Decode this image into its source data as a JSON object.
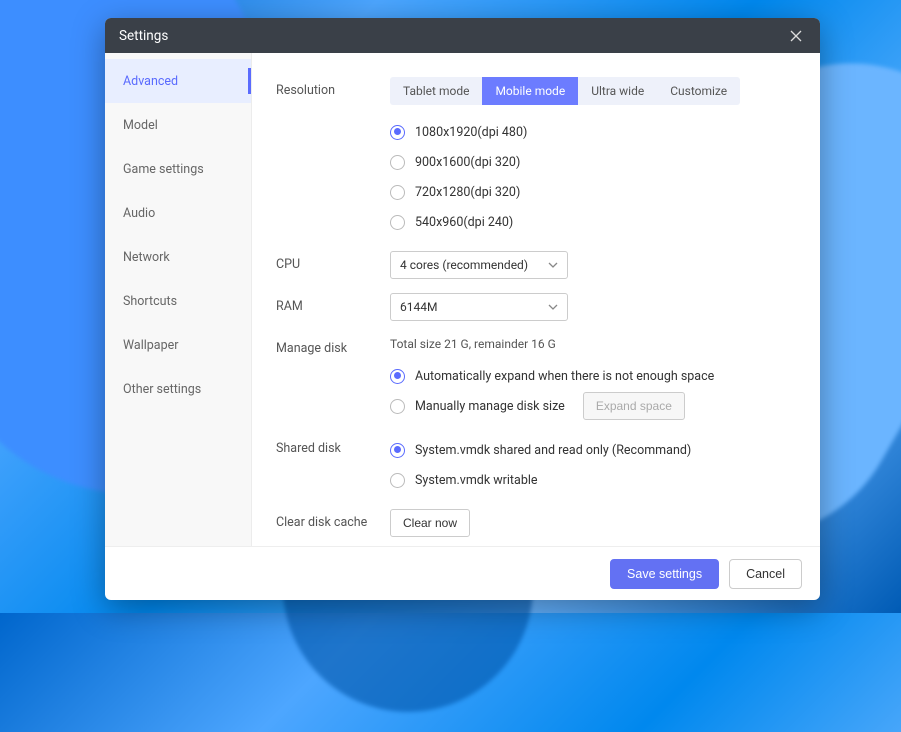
{
  "title": "Settings",
  "sidebar": {
    "items": [
      {
        "label": "Advanced",
        "active": true
      },
      {
        "label": "Model"
      },
      {
        "label": "Game settings"
      },
      {
        "label": "Audio"
      },
      {
        "label": "Network"
      },
      {
        "label": "Shortcuts"
      },
      {
        "label": "Wallpaper"
      },
      {
        "label": "Other settings"
      }
    ]
  },
  "resolution": {
    "label": "Resolution",
    "modes": [
      {
        "label": "Tablet mode"
      },
      {
        "label": "Mobile mode",
        "active": true
      },
      {
        "label": "Ultra wide"
      },
      {
        "label": "Customize"
      }
    ],
    "options": [
      {
        "label": "1080x1920(dpi 480)",
        "checked": true
      },
      {
        "label": "900x1600(dpi 320)"
      },
      {
        "label": "720x1280(dpi 320)"
      },
      {
        "label": "540x960(dpi 240)"
      }
    ]
  },
  "cpu": {
    "label": "CPU",
    "value": "4 cores (recommended)"
  },
  "ram": {
    "label": "RAM",
    "value": "6144M"
  },
  "disk": {
    "label": "Manage disk",
    "info": "Total size 21 G, remainder 16 G",
    "options": [
      {
        "label": "Automatically expand when there is not enough space",
        "checked": true
      },
      {
        "label": "Manually manage disk size"
      }
    ],
    "expand_btn": "Expand space"
  },
  "shared": {
    "label": "Shared disk",
    "options": [
      {
        "label": "System.vmdk shared and read only (Recommand)",
        "checked": true
      },
      {
        "label": "System.vmdk writable"
      }
    ]
  },
  "cache": {
    "label": "Clear disk cache",
    "btn": "Clear now"
  },
  "footer": {
    "save": "Save settings",
    "cancel": "Cancel"
  }
}
